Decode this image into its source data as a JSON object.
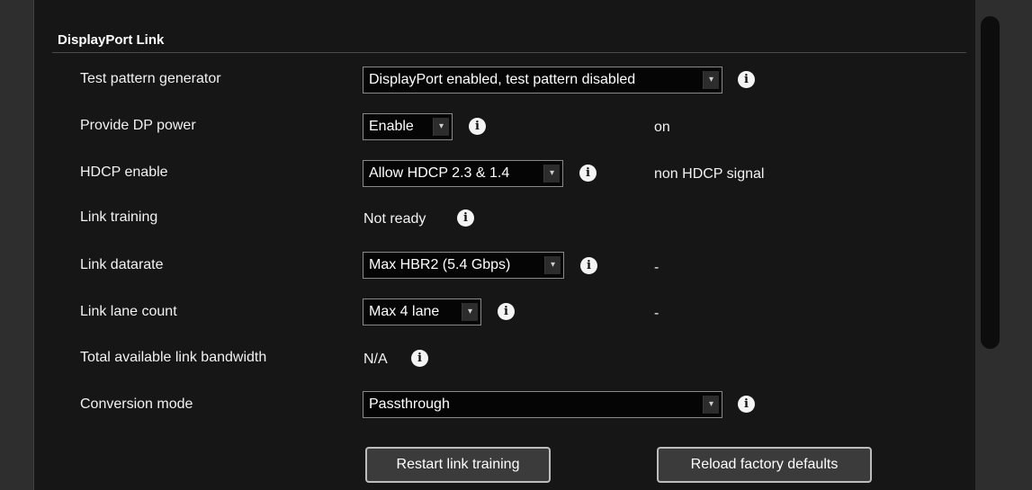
{
  "section": {
    "title": "DisplayPort Link"
  },
  "rows": {
    "test_pattern": {
      "label": "Test pattern generator",
      "selected": "DisplayPort enabled, test pattern disabled"
    },
    "dp_power": {
      "label": "Provide DP power",
      "selected": "Enable",
      "status": "on"
    },
    "hdcp": {
      "label": "HDCP enable",
      "selected": "Allow HDCP 2.3 & 1.4",
      "status": "non HDCP signal"
    },
    "link_training": {
      "label": "Link training",
      "value": "Not ready"
    },
    "link_datarate": {
      "label": "Link datarate",
      "selected": "Max HBR2 (5.4 Gbps)",
      "status": "-"
    },
    "link_lane_count": {
      "label": "Link lane count",
      "selected": "Max 4 lane",
      "status": "-"
    },
    "bandwidth": {
      "label": "Total available link bandwidth",
      "value": "N/A"
    },
    "conversion_mode": {
      "label": "Conversion mode",
      "selected": "Passthrough"
    }
  },
  "buttons": {
    "restart_link_training": "Restart link training",
    "reload_factory_defaults": "Reload factory defaults"
  },
  "icons": {
    "info_glyph": "i",
    "caret_glyph": "▾"
  },
  "colors": {
    "panel_background": "#161616",
    "outer_background": "#2e2e2e",
    "text": "#f2f2f2",
    "select_background": "#050505"
  }
}
